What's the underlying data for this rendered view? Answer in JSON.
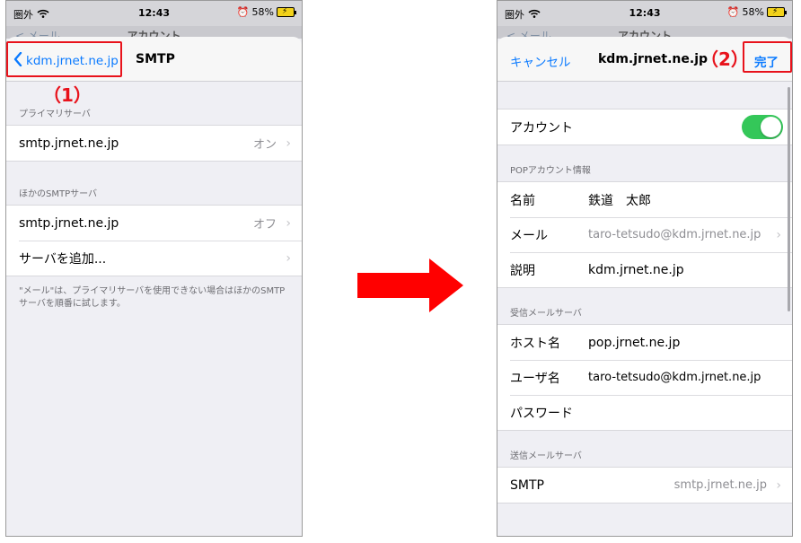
{
  "status": {
    "carrier": "圏外",
    "time": "12:43",
    "battery": "58%"
  },
  "left": {
    "behind_back": "< メール",
    "behind_title": "アカウント",
    "back_label": "kdm.jrnet.ne.jp",
    "title": "SMTP",
    "annotation": "（1）",
    "primary_header": "プライマリサーバ",
    "primary_server": {
      "name": "smtp.jrnet.ne.jp",
      "state": "オン"
    },
    "other_header": "ほかのSMTPサーバ",
    "other_server": {
      "name": "smtp.jrnet.ne.jp",
      "state": "オフ"
    },
    "add_server": "サーバを追加...",
    "footer": "\"メール\"は、プライマリサーバを使用できない場合はほかのSMTPサーバを順番に試します。"
  },
  "right": {
    "behind_back": "< メール",
    "behind_title": "アカウント",
    "cancel": "キャンセル",
    "title": "kdm.jrnet.ne.jp",
    "annotation": "（2）",
    "done": "完了",
    "account_label": "アカウント",
    "account_on": true,
    "pop_header": "POPアカウント情報",
    "name_label": "名前",
    "name_value": "鉄道　太郎",
    "mail_label": "メール",
    "mail_value": "taro-tetsudo@kdm.jrnet.ne.jp",
    "desc_label": "説明",
    "desc_value": "kdm.jrnet.ne.jp",
    "incoming_header": "受信メールサーバ",
    "host_label": "ホスト名",
    "host_value": "pop.jrnet.ne.jp",
    "user_label": "ユーザ名",
    "user_value": "taro-tetsudo@kdm.jrnet.ne.jp",
    "pass_label": "パスワード",
    "outgoing_header": "送信メールサーバ",
    "smtp_label": "SMTP",
    "smtp_value": "smtp.jrnet.ne.jp"
  },
  "colors": {
    "accent": "#0a7aff",
    "annotation": "#e8121b",
    "toggle_on": "#34c759"
  }
}
